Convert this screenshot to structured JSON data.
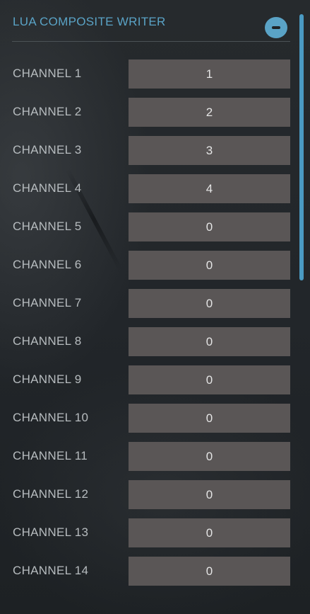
{
  "panel": {
    "title": "LUA COMPOSITE WRITER",
    "collapse_button_icon": "minus-circle-icon"
  },
  "colors": {
    "accent": "#5aa3c6",
    "background": "#22262a",
    "input_bg": "#5a5656",
    "label_text": "#b7bcbf"
  },
  "channels": [
    {
      "label": "CHANNEL 1",
      "value": "1"
    },
    {
      "label": "CHANNEL 2",
      "value": "2"
    },
    {
      "label": "CHANNEL 3",
      "value": "3"
    },
    {
      "label": "CHANNEL 4",
      "value": "4"
    },
    {
      "label": "CHANNEL 5",
      "value": "0"
    },
    {
      "label": "CHANNEL 6",
      "value": "0"
    },
    {
      "label": "CHANNEL 7",
      "value": "0"
    },
    {
      "label": "CHANNEL 8",
      "value": "0"
    },
    {
      "label": "CHANNEL 9",
      "value": "0"
    },
    {
      "label": "CHANNEL 10",
      "value": "0"
    },
    {
      "label": "CHANNEL 11",
      "value": "0"
    },
    {
      "label": "CHANNEL 12",
      "value": "0"
    },
    {
      "label": "CHANNEL 13",
      "value": "0"
    },
    {
      "label": "CHANNEL 14",
      "value": "0"
    }
  ]
}
